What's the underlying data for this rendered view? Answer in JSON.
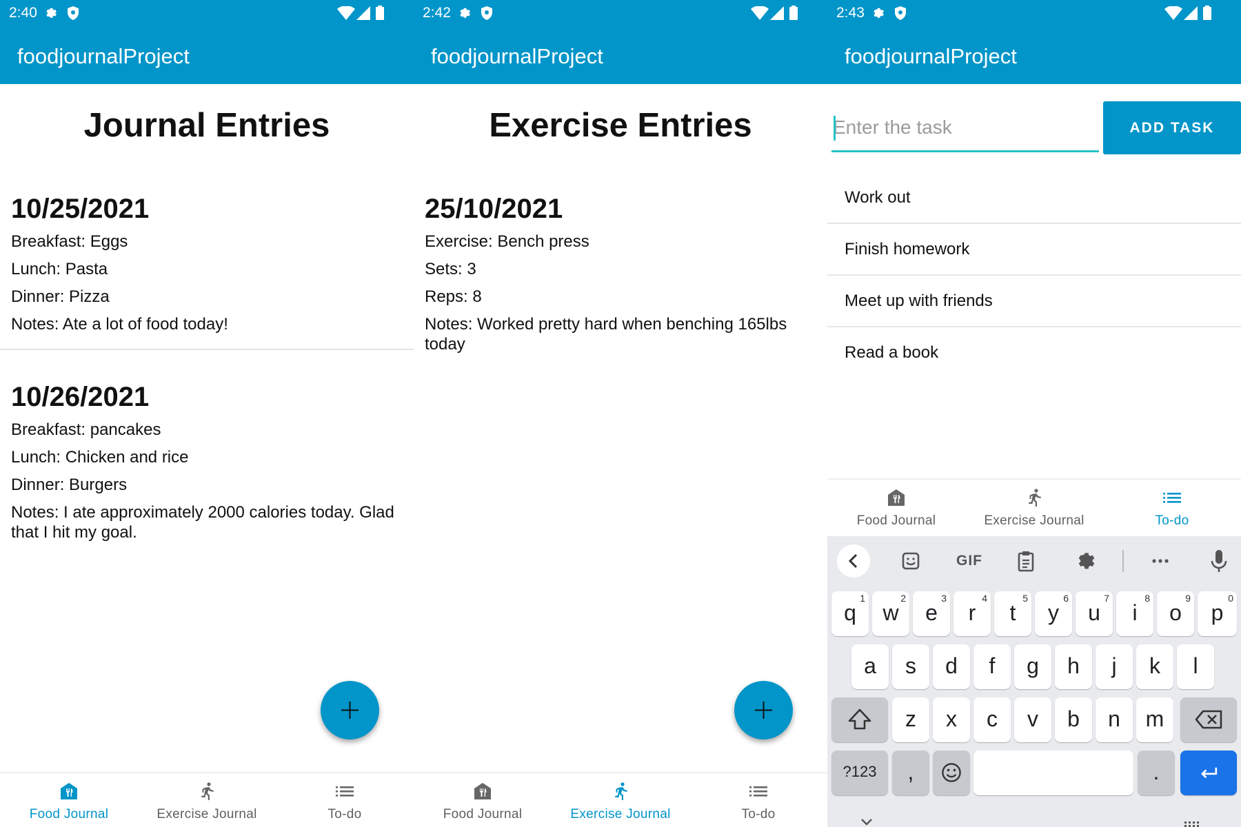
{
  "app_title": "foodjournalProject",
  "phones": [
    {
      "time": "2:40"
    },
    {
      "time": "2:42"
    },
    {
      "time": "2:43"
    }
  ],
  "nav": {
    "food": "Food Journal",
    "exercise": "Exercise Journal",
    "todo": "To-do"
  },
  "journal": {
    "heading": "Journal Entries",
    "entries": [
      {
        "date": "10/25/2021",
        "lines": [
          "Breakfast: Eggs",
          "Lunch: Pasta",
          "Dinner: Pizza",
          "Notes: Ate a lot of food today!"
        ]
      },
      {
        "date": "10/26/2021",
        "lines": [
          "Breakfast: pancakes",
          "Lunch: Chicken and rice",
          "Dinner: Burgers",
          "Notes: I ate approximately 2000 calories today. Glad that I hit my goal."
        ]
      }
    ]
  },
  "exercise": {
    "heading": "Exercise Entries",
    "entries": [
      {
        "date": "25/10/2021",
        "lines": [
          "Exercise: Bench press",
          "Sets: 3",
          "Reps: 8",
          "Notes: Worked pretty hard when benching 165lbs today"
        ]
      }
    ]
  },
  "todo": {
    "input_placeholder": "Enter the task",
    "add_button": "ADD TASK",
    "tasks": [
      "Work out",
      "Finish homework",
      "Meet up with friends",
      "Read a book"
    ]
  },
  "keyboard": {
    "gif": "GIF",
    "row1": [
      "q",
      "w",
      "e",
      "r",
      "t",
      "y",
      "u",
      "i",
      "o",
      "p"
    ],
    "row1_hints": [
      "1",
      "2",
      "3",
      "4",
      "5",
      "6",
      "7",
      "8",
      "9",
      "0"
    ],
    "row2": [
      "a",
      "s",
      "d",
      "f",
      "g",
      "h",
      "j",
      "k",
      "l"
    ],
    "row3": [
      "z",
      "x",
      "c",
      "v",
      "b",
      "n",
      "m"
    ],
    "symbols": "?123",
    "comma": ",",
    "period": "."
  },
  "colors": {
    "primary": "#0195c9",
    "accent": "#26c3c3",
    "keyboard_enter": "#1a73e8"
  }
}
